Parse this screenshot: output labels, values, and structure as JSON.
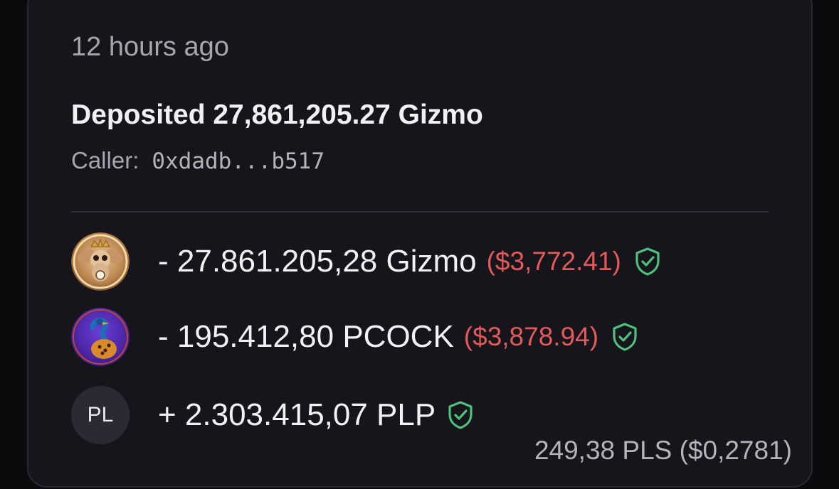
{
  "activity": {
    "timestamp": "12 hours ago",
    "title": "Deposited 27,861,205.27 Gizmo",
    "caller_label": "Caller:",
    "caller_address": "0xdadb...b517"
  },
  "transfers": [
    {
      "icon": "gizmo-token-icon",
      "amount": "- 27.861.205,28 Gizmo",
      "usd": "($3,772.41)",
      "verified": true
    },
    {
      "icon": "pcock-token-icon",
      "amount": "- 195.412,80 PCOCK",
      "usd": "($3,878.94)",
      "verified": true
    },
    {
      "icon": "pl-token-icon",
      "avatar_text": "PL",
      "amount": "+ 2.303.415,07 PLP",
      "verified": true
    }
  ],
  "fee": "249,38 PLS ($0,2781)",
  "colors": {
    "negative_usd": "#e25a5a",
    "verified_shield": "#4fc17c",
    "card_bg": "#16151c"
  }
}
